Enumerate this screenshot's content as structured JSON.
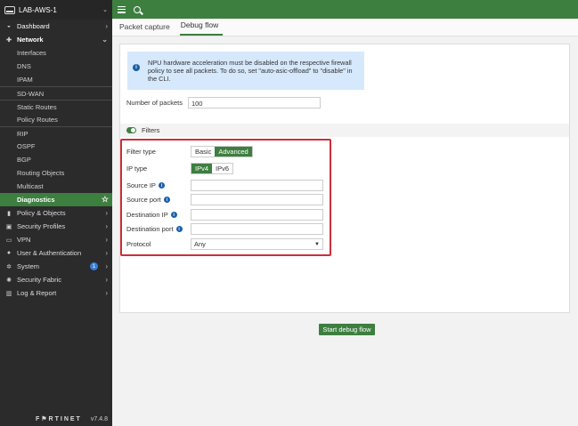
{
  "sidebar": {
    "device": "LAB-AWS-1",
    "items": [
      {
        "label": "Dashboard",
        "icon": "dashboard-icon",
        "glyph": "◒",
        "arrow": "›"
      },
      {
        "label": "Network",
        "icon": "network-icon",
        "glyph": "✚",
        "arrow": "⌄"
      },
      {
        "label": "Interfaces"
      },
      {
        "label": "DNS"
      },
      {
        "label": "IPAM"
      },
      {
        "label": "SD-WAN"
      },
      {
        "label": "Static Routes"
      },
      {
        "label": "Policy Routes"
      },
      {
        "label": "RIP"
      },
      {
        "label": "OSPF"
      },
      {
        "label": "BGP"
      },
      {
        "label": "Routing Objects"
      },
      {
        "label": "Multicast"
      },
      {
        "label": "Diagnostics"
      },
      {
        "label": "Policy & Objects",
        "icon": "policy-icon",
        "glyph": "▮",
        "arrow": "›"
      },
      {
        "label": "Security Profiles",
        "icon": "lock-icon",
        "glyph": "▣",
        "arrow": "›"
      },
      {
        "label": "VPN",
        "icon": "monitor-icon",
        "glyph": "▭",
        "arrow": "›"
      },
      {
        "label": "User & Authentication",
        "icon": "user-icon",
        "glyph": "●",
        "arrow": "›"
      },
      {
        "label": "System",
        "icon": "gear-icon",
        "glyph": "✲",
        "arrow": "›",
        "badge": "1"
      },
      {
        "label": "Security Fabric",
        "icon": "fabric-icon",
        "glyph": "✺",
        "arrow": "›"
      },
      {
        "label": "Log & Report",
        "icon": "chart-icon",
        "glyph": "▥",
        "arrow": "›"
      }
    ],
    "footer_logo": "F⚑RTINET",
    "version": "v7.4.8"
  },
  "tabs": [
    "Packet capture",
    "Debug flow"
  ],
  "notice": "NPU hardware acceleration must be disabled on the respective firewall policy to see all packets. To do so, set \"auto-asic-offload\" to \"disable\" in the CLI.",
  "packets": {
    "label": "Number of packets",
    "value": "100"
  },
  "filters": {
    "title": "Filters",
    "filter_type": {
      "label": "Filter type",
      "options": [
        "Basic",
        "Advanced"
      ],
      "selected": "Advanced"
    },
    "ip_type": {
      "label": "IP type",
      "options": [
        "IPv4",
        "IPv6"
      ],
      "selected": "IPv4"
    },
    "source_ip": "Source IP",
    "source_port": "Source port",
    "destination_ip": "Destination IP",
    "destination_port": "Destination port",
    "protocol": {
      "label": "Protocol",
      "value": "Any"
    }
  },
  "start_button": "Start debug flow",
  "colors": {
    "accent": "#3d7f3f",
    "highlight": "#cc2e3a",
    "notice_bg": "#d6e8fb"
  }
}
